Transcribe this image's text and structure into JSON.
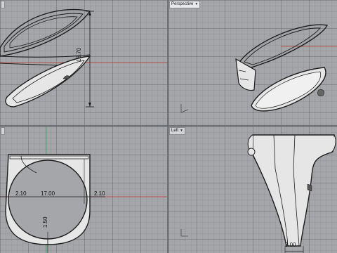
{
  "viewports": {
    "top": {
      "label": ""
    },
    "perspective": {
      "label": "Perspective"
    },
    "front": {
      "label": ""
    },
    "left": {
      "label": "Left"
    }
  },
  "dimensions": {
    "height": "18.70",
    "inner_diameter": "17.00",
    "left_thickness": "2.10",
    "right_thickness": "2.10",
    "bottom_thickness": "1.50",
    "base_width": "3.00"
  },
  "colors": {
    "viewport_bg": "#a4a6a9",
    "x_axis": "#c43a3a",
    "y_axis": "#3aa05a",
    "model_fill": "#e6e6e6",
    "model_stroke": "#202020"
  }
}
